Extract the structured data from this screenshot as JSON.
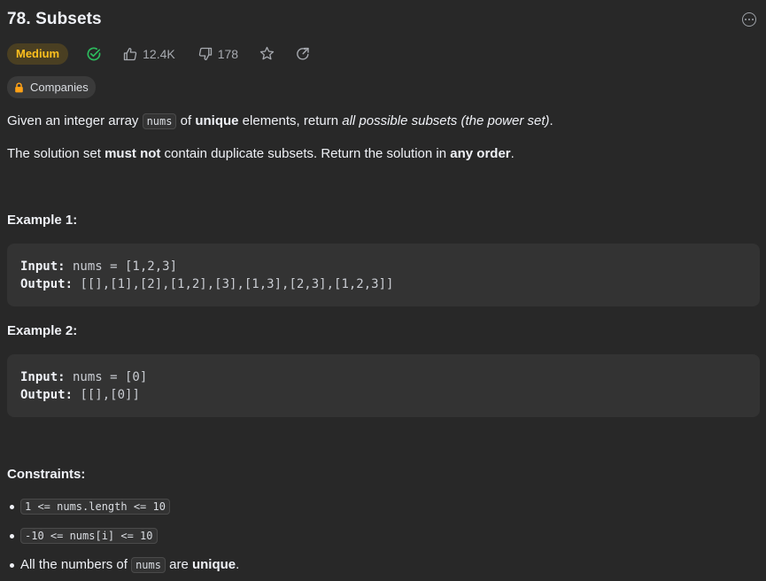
{
  "problem": {
    "title": "78. Subsets",
    "difficulty": "Medium",
    "likes": "12.4K",
    "dislikes": "178",
    "companies_label": "Companies"
  },
  "description": {
    "p1": {
      "t1": "Given an integer array ",
      "code1": "nums",
      "t2": " of ",
      "b1": "unique",
      "t3": " elements, return ",
      "i1": "all possible subsets (the power set)",
      "t4": "."
    },
    "p2": {
      "t1": "The solution set ",
      "b1": "must not",
      "t2": " contain duplicate subsets. Return the solution in ",
      "b2": "any order",
      "t3": "."
    }
  },
  "examples": [
    {
      "heading": "Example 1:",
      "input_label": "Input:",
      "input_value": " nums = [1,2,3]",
      "output_label": "Output:",
      "output_value": " [[],[1],[2],[1,2],[3],[1,3],[2,3],[1,2,3]]"
    },
    {
      "heading": "Example 2:",
      "input_label": "Input:",
      "input_value": " nums = [0]",
      "output_label": "Output:",
      "output_value": " [[],[0]]"
    }
  ],
  "constraints": {
    "heading": "Constraints:",
    "c1": "1 <= nums.length <= 10",
    "c2": "-10 <= nums[i] <= 10",
    "c3": {
      "t1": "All the numbers of ",
      "code1": "nums",
      "t2": " are ",
      "b1": "unique",
      "t3": "."
    }
  },
  "icons": {
    "solved": "check-circle-icon",
    "like": "thumbs-up-icon",
    "dislike": "thumbs-down-icon",
    "favorite": "star-icon",
    "share": "share-icon",
    "lock": "lock-icon",
    "more": "more-icon"
  },
  "colors": {
    "background": "#282828",
    "difficulty_medium": "#ffc01e",
    "solved_green": "#2cbb5d",
    "lock_orange": "#ffa116"
  }
}
